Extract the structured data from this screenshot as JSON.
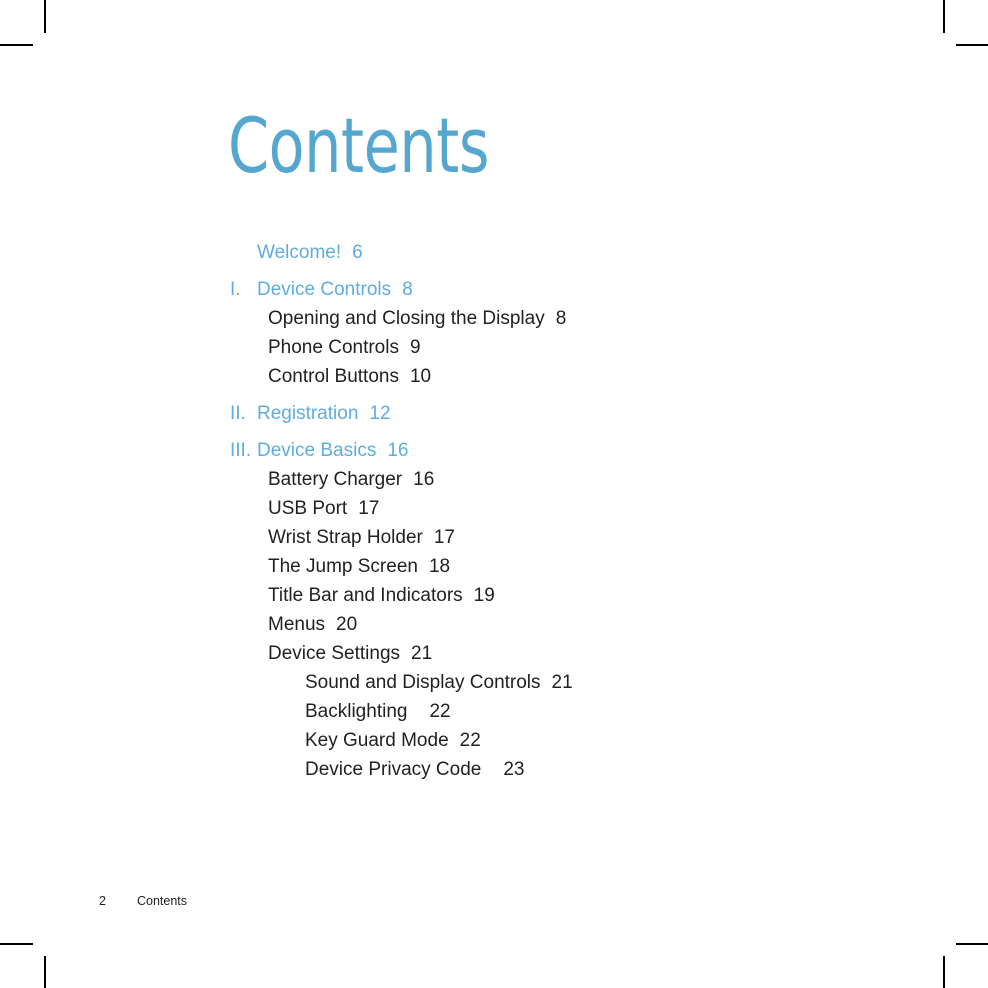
{
  "page": {
    "title": "Contents",
    "accent_color": "#5fade0",
    "title_color": "#56a7cf",
    "text_color": "#231f20",
    "background_color": "#ffffff"
  },
  "toc": {
    "entries": [
      {
        "num": "",
        "label": "Welcome!",
        "page": "6",
        "level": 0,
        "wide": false
      },
      {
        "num": "I.",
        "label": "Device Controls",
        "page": "8",
        "level": 0,
        "wide": false
      },
      {
        "num": "",
        "label": "Opening and Closing the Display",
        "page": "8",
        "level": 1,
        "wide": false
      },
      {
        "num": "",
        "label": "Phone Controls",
        "page": "9",
        "level": 1,
        "wide": false
      },
      {
        "num": "",
        "label": "Control Buttons",
        "page": "10",
        "level": 1,
        "wide": false
      },
      {
        "num": "II.",
        "label": "Registration",
        "page": "12",
        "level": 0,
        "wide": false
      },
      {
        "num": "III.",
        "label": "Device Basics",
        "page": "16",
        "level": 0,
        "wide": false
      },
      {
        "num": "",
        "label": "Battery Charger",
        "page": "16",
        "level": 1,
        "wide": false
      },
      {
        "num": "",
        "label": "USB Port",
        "page": "17",
        "level": 1,
        "wide": false
      },
      {
        "num": "",
        "label": "Wrist Strap Holder",
        "page": "17",
        "level": 1,
        "wide": false
      },
      {
        "num": "",
        "label": "The Jump Screen",
        "page": "18",
        "level": 1,
        "wide": false
      },
      {
        "num": "",
        "label": "Title Bar and Indicators",
        "page": "19",
        "level": 1,
        "wide": false
      },
      {
        "num": "",
        "label": "Menus",
        "page": "20",
        "level": 1,
        "wide": false
      },
      {
        "num": "",
        "label": "Device Settings",
        "page": "21",
        "level": 1,
        "wide": false
      },
      {
        "num": "",
        "label": "Sound and Display Controls",
        "page": "21",
        "level": 2,
        "wide": false
      },
      {
        "num": "",
        "label": "Backlighting",
        "page": "22",
        "level": 2,
        "wide": true
      },
      {
        "num": "",
        "label": "Key Guard Mode",
        "page": "22",
        "level": 2,
        "wide": false
      },
      {
        "num": "",
        "label": "Device Privacy Code",
        "page": "23",
        "level": 2,
        "wide": true
      }
    ]
  },
  "footer": {
    "page_number": "2",
    "section_label": "Contents"
  }
}
